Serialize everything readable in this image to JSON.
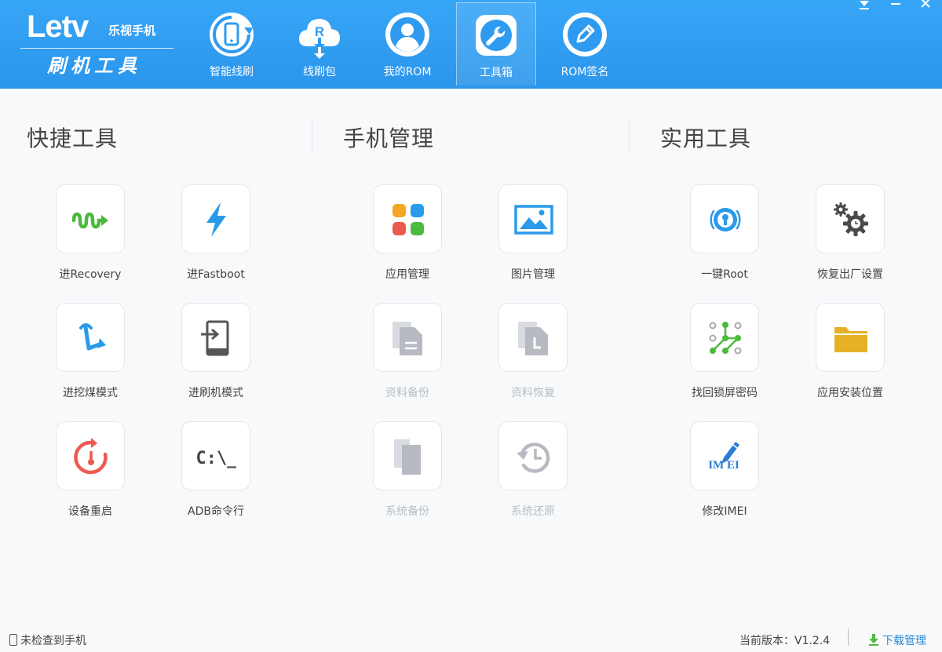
{
  "header": {
    "logo_brand": "Letv",
    "logo_sub": "乐视手机",
    "logo_title": "刷机工具",
    "nav": [
      {
        "label": "智能线刷",
        "icon": "phone-refresh-icon"
      },
      {
        "label": "线刷包",
        "icon": "cloud-download-icon"
      },
      {
        "label": "我的ROM",
        "icon": "user-icon"
      },
      {
        "label": "工具箱",
        "icon": "wrench-icon",
        "active": true
      },
      {
        "label": "ROM签名",
        "icon": "pen-icon"
      }
    ]
  },
  "sections": {
    "quick": {
      "title": "快捷工具",
      "items": [
        {
          "label": "进Recovery",
          "icon": "recovery-wave-icon"
        },
        {
          "label": "进Fastboot",
          "icon": "lightning-icon"
        },
        {
          "label": "进挖煤模式",
          "icon": "pickaxe-icon"
        },
        {
          "label": "进刷机模式",
          "icon": "enter-phone-icon"
        },
        {
          "label": "设备重启",
          "icon": "restart-icon"
        },
        {
          "label": "ADB命令行",
          "icon": "terminal-icon",
          "glyph": "C:\\_"
        }
      ]
    },
    "phone": {
      "title": "手机管理",
      "items": [
        {
          "label": "应用管理",
          "icon": "apps-grid-icon"
        },
        {
          "label": "图片管理",
          "icon": "image-icon"
        },
        {
          "label": "资料备份",
          "icon": "document-icon",
          "disabled": true
        },
        {
          "label": "资料恢复",
          "icon": "document-clock-icon",
          "disabled": true
        },
        {
          "label": "系统备份",
          "icon": "copy-icon",
          "disabled": true
        },
        {
          "label": "系统还原",
          "icon": "history-icon",
          "disabled": true
        }
      ]
    },
    "utility": {
      "title": "实用工具",
      "items": [
        {
          "label": "一键Root",
          "icon": "keyhole-icon"
        },
        {
          "label": "恢复出厂设置",
          "icon": "gears-icon"
        },
        {
          "label": "找回锁屏密码",
          "icon": "pattern-lock-icon"
        },
        {
          "label": "应用安装位置",
          "icon": "folder-icon"
        },
        {
          "label": "修改IMEI",
          "icon": "imei-pen-icon",
          "glyph": "IM EI"
        }
      ]
    }
  },
  "status": {
    "device": "未检查到手机",
    "version": "当前版本：V1.2.4",
    "download": "下载管理"
  },
  "colors": {
    "header": "#2f9bf0",
    "accent_blue": "#2a9aea",
    "green": "#4cba3c",
    "red": "#ec5b4f",
    "folder": "#e6b127",
    "disabled": "#c7cacf"
  }
}
